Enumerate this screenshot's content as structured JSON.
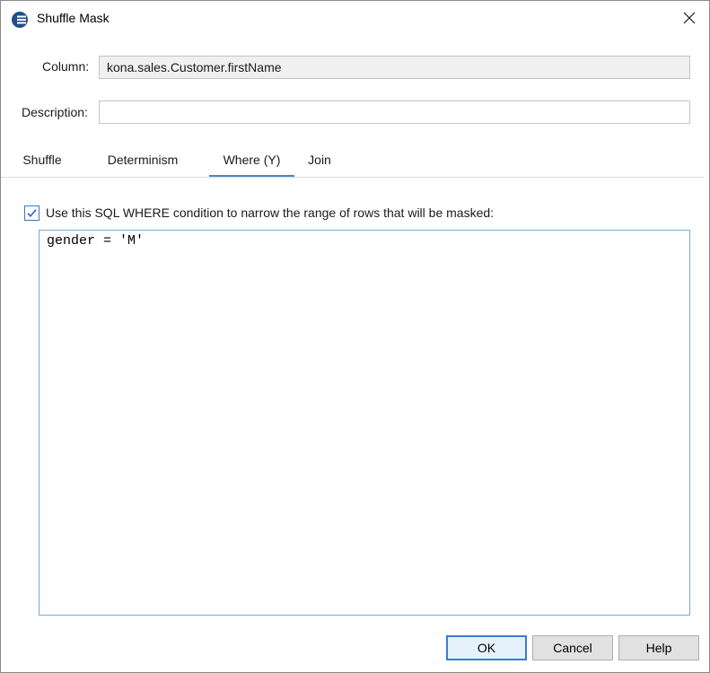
{
  "window": {
    "title": "Shuffle Mask",
    "close_glyph": "✕",
    "icon": "database-app-icon"
  },
  "form": {
    "column_label": "Column:",
    "column_value": "kona.sales.Customer.firstName",
    "description_label": "Description:",
    "description_value": ""
  },
  "tabs": [
    {
      "label": "Shuffle",
      "active": false
    },
    {
      "label": "Determinism",
      "active": false
    },
    {
      "label": "Where (Y)",
      "active": true
    },
    {
      "label": "Join",
      "active": false
    }
  ],
  "where": {
    "checkbox_checked": true,
    "checkbox_label": "Use this SQL WHERE condition to narrow the range of rows that will be masked:",
    "sql": "gender = 'M'"
  },
  "buttons": {
    "ok": "OK",
    "cancel": "Cancel",
    "help": "Help"
  },
  "colors": {
    "accent": "#4a86c5",
    "default_button_border": "#3a7bd5"
  }
}
